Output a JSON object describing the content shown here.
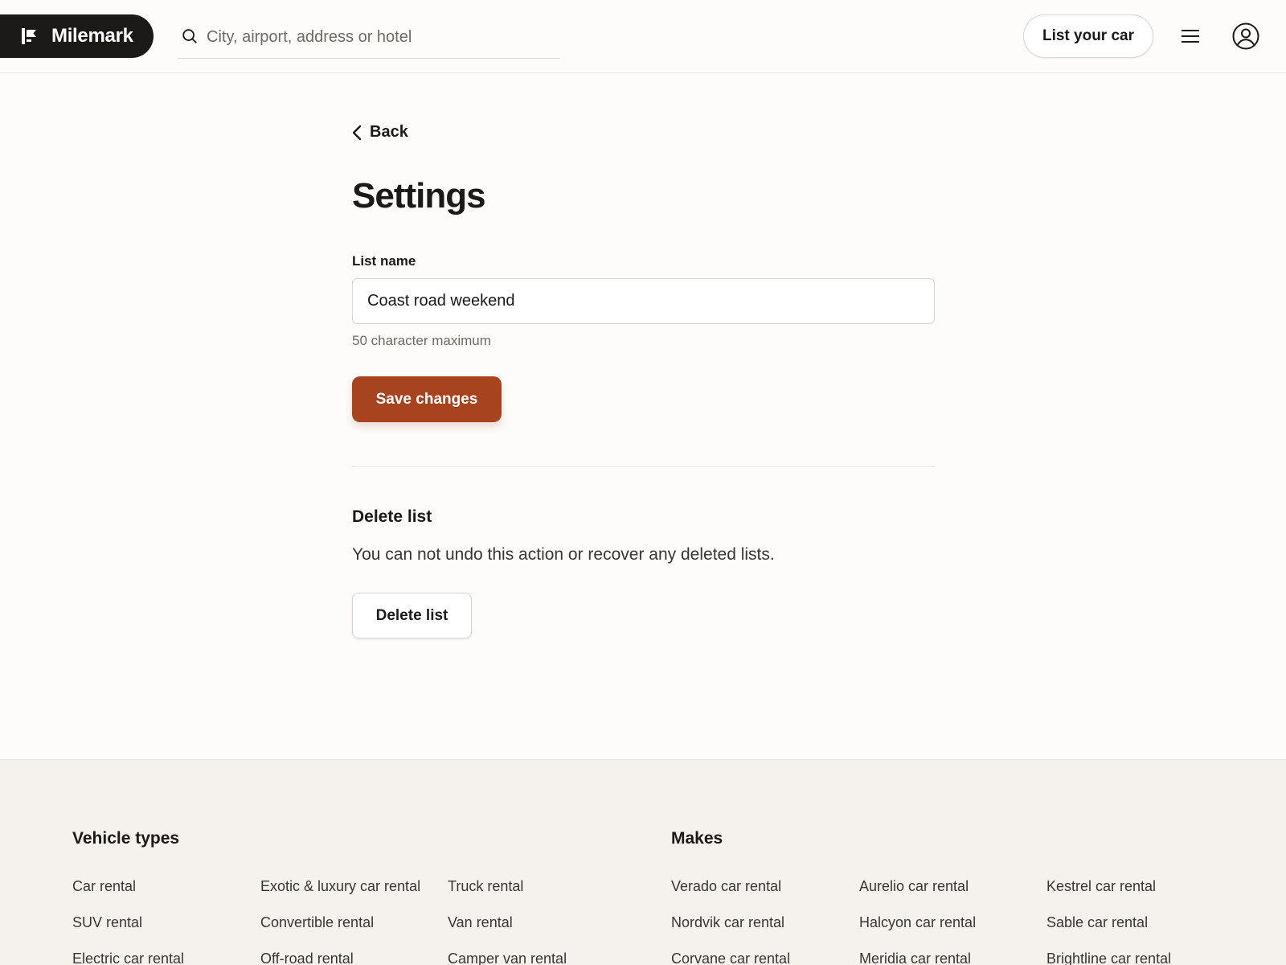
{
  "header": {
    "brand": "Milemark",
    "search_placeholder": "City, airport, address or hotel",
    "list_car_label": "List your car"
  },
  "main": {
    "back_label": "Back",
    "title": "Settings",
    "list_name_label": "List name",
    "list_name_value": "Coast road weekend",
    "helper_text": "50 character maximum",
    "save_label": "Save changes",
    "delete_heading": "Delete list",
    "delete_text": "You can not undo this action or recover any deleted lists.",
    "delete_label": "Delete list"
  },
  "footer": {
    "vehicle_types_heading": "Vehicle types",
    "vehicle_types": [
      [
        "Car rental",
        "SUV rental",
        "Electric car rental"
      ],
      [
        "Exotic & luxury car rental",
        "Convertible rental",
        "Off-road rental"
      ],
      [
        "Truck rental",
        "Van rental",
        "Camper van rental"
      ]
    ],
    "makes_heading": "Makes",
    "makes": [
      [
        "Verado car rental",
        "Nordvik car rental",
        "Corvane car rental"
      ],
      [
        "Aurelio car rental",
        "Halcyon car rental",
        "Meridia car rental"
      ],
      [
        "Kestrel car rental",
        "Sable car rental",
        "Brightline car rental"
      ]
    ]
  },
  "colors": {
    "primary": "#a8431f",
    "ink": "#1c1a18",
    "footer_bg": "#f5f2ee"
  }
}
